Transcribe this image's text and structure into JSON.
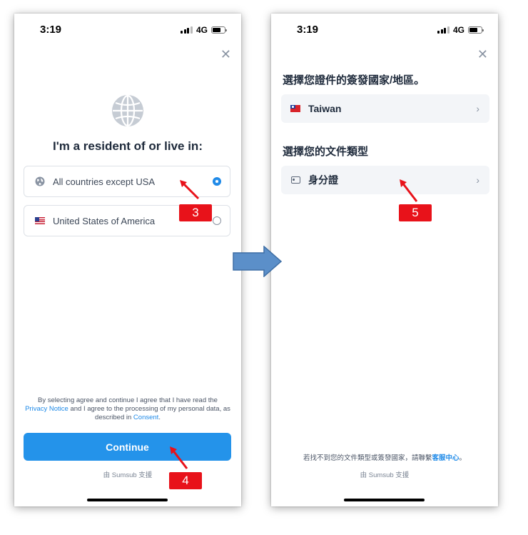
{
  "status_bar": {
    "time": "3:19",
    "network": "4G"
  },
  "left_screen": {
    "heading": "I'm a resident of or live in:",
    "options": [
      {
        "label": "All countries except USA",
        "selected": true
      },
      {
        "label": "United States of America",
        "selected": false
      }
    ],
    "disclaimer": {
      "part1": "By selecting agree and continue I agree that I have read the",
      "privacy_link": "Privacy Notice",
      "part2": " and I agree to the processing of my personal data, as described in ",
      "consent_link": "Consent",
      "part3": "."
    },
    "continue_label": "Continue",
    "powered_by": "由 Sumsub 支援"
  },
  "right_screen": {
    "country_title": "選擇您證件的簽發國家/地區。",
    "country_value": "Taiwan",
    "doc_title": "選擇您的文件類型",
    "doc_value": "身分證",
    "help_prefix": "若找不到您的文件類型或簽發國家，請聯繫",
    "help_link": "客服中心",
    "help_suffix": "。",
    "powered_by": "由 Sumsub 支援"
  },
  "annotations": {
    "callout_3": "3",
    "callout_4": "4",
    "callout_5": "5"
  },
  "colors": {
    "accent": "#2493ea",
    "callout": "#e8121a",
    "arrow": "#5b8fc9"
  },
  "icons": [
    "globe-icon",
    "close-icon",
    "chevron-right-icon",
    "id-card-icon",
    "us-flag-icon",
    "taiwan-flag-icon"
  ]
}
